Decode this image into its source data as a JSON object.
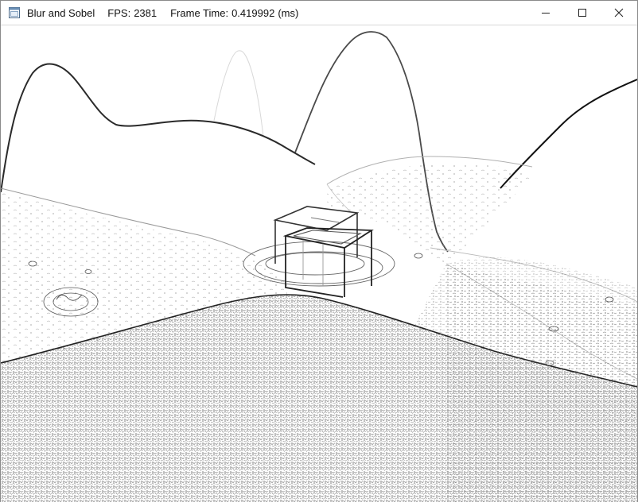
{
  "window": {
    "title": "Blur and Sobel",
    "fps_label": "FPS:",
    "fps_value": "2381",
    "frame_time_label": "Frame Time:",
    "frame_time_value": "0.419992",
    "frame_time_unit": "(ms)"
  },
  "icons": {
    "app": "app-window-icon",
    "minimize": "minimize-icon",
    "maximize": "maximize-icon",
    "close": "close-icon"
  },
  "scene": {
    "background": "#fdfdfd",
    "edge_color": "#1a1a1a",
    "light_edge_color": "#9a9a9a",
    "noise_color": "#555555"
  }
}
